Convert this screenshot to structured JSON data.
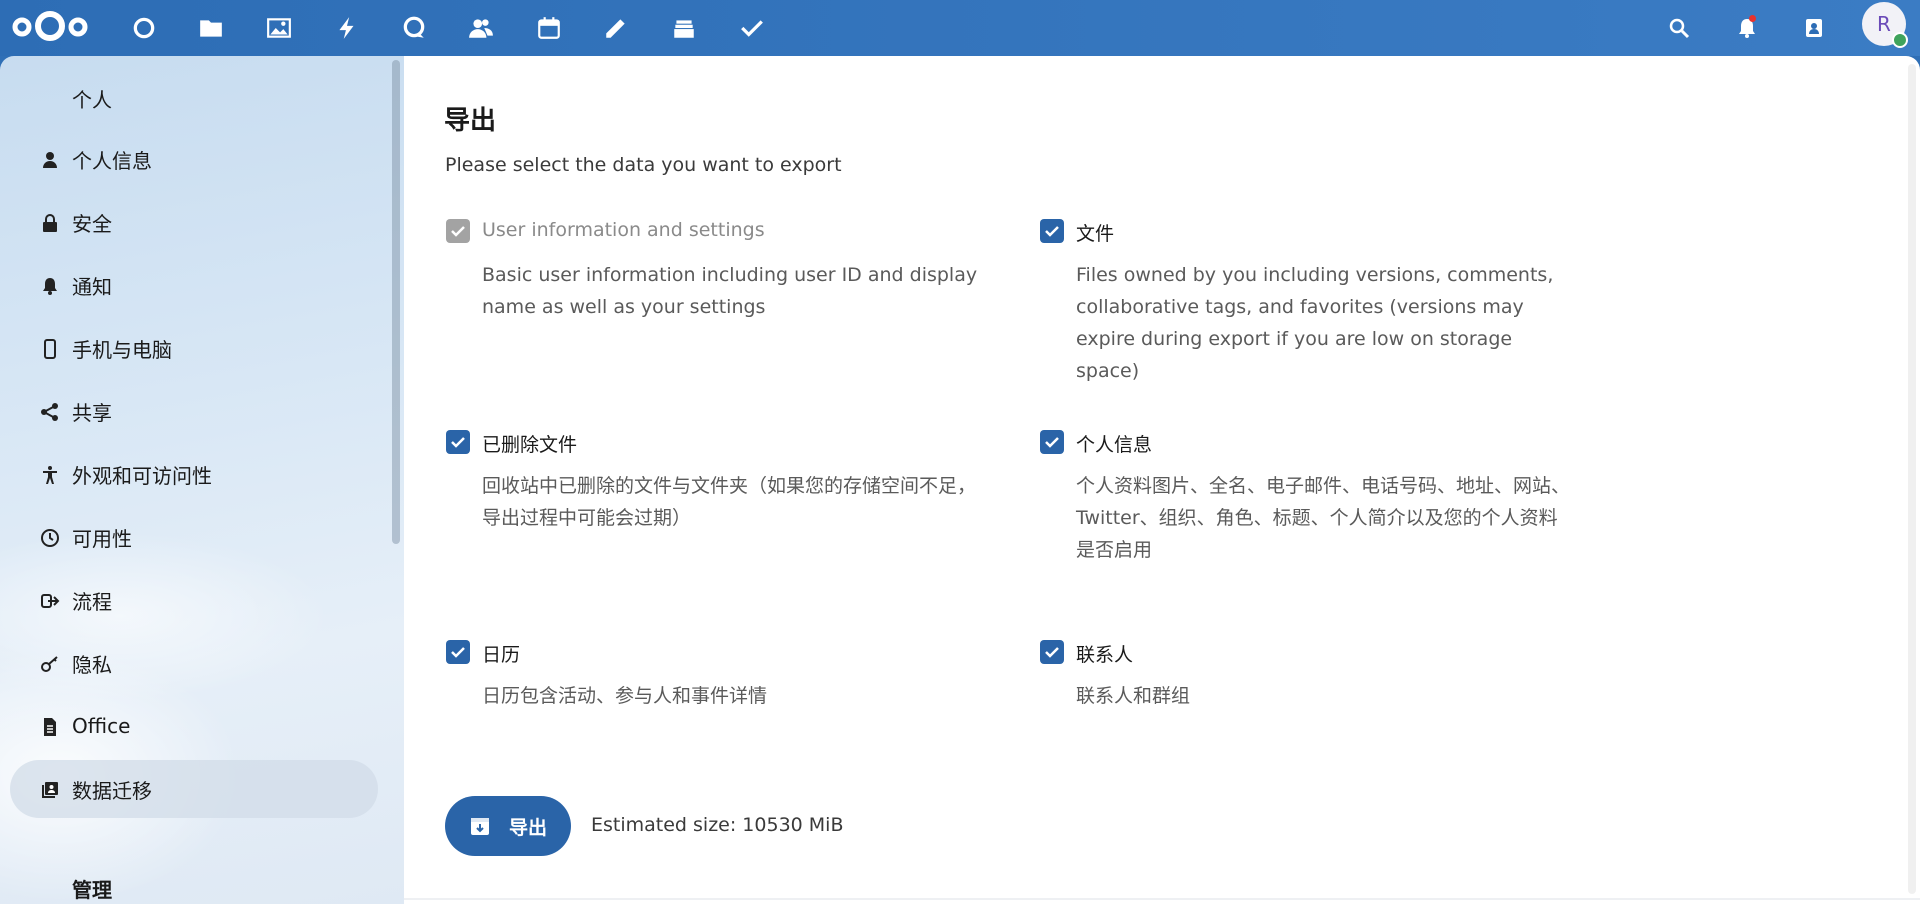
{
  "header": {
    "apps": [
      {
        "icon": "dashboard-icon"
      },
      {
        "icon": "files-icon"
      },
      {
        "icon": "photos-icon"
      },
      {
        "icon": "activity-icon"
      },
      {
        "icon": "talk-icon"
      },
      {
        "icon": "contacts-icon"
      },
      {
        "icon": "calendar-icon"
      },
      {
        "icon": "notes-icon"
      },
      {
        "icon": "deck-icon"
      },
      {
        "icon": "tasks-icon"
      }
    ],
    "avatar_letter": "R"
  },
  "sidebar": {
    "personal_title": "个人",
    "items": [
      {
        "label": "个人信息",
        "icon": "person-icon"
      },
      {
        "label": "安全",
        "icon": "lock-icon"
      },
      {
        "label": "通知",
        "icon": "bell-icon"
      },
      {
        "label": "手机与电脑",
        "icon": "phone-icon"
      },
      {
        "label": "共享",
        "icon": "share-icon"
      },
      {
        "label": "外观和可访问性",
        "icon": "accessibility-icon"
      },
      {
        "label": "可用性",
        "icon": "clock-icon"
      },
      {
        "label": "流程",
        "icon": "flow-icon"
      },
      {
        "label": "隐私",
        "icon": "key-icon"
      },
      {
        "label": "Office",
        "icon": "document-icon"
      },
      {
        "label": "数据迁移",
        "icon": "migration-icon"
      }
    ],
    "admin_title": "管理"
  },
  "main": {
    "title": "导出",
    "subtitle": "Please select the data you want to export",
    "options": [
      {
        "label": "User information and settings",
        "desc": "Basic user information including user ID and display name as well as your settings",
        "checked": true,
        "disabled": true
      },
      {
        "label": "文件",
        "desc": "Files owned by you including versions, comments, collaborative tags, and favorites (versions may expire during export if you are low on storage space)",
        "checked": true,
        "disabled": false
      },
      {
        "label": "已删除文件",
        "desc": "回收站中已删除的文件与文件夹（如果您的存储空间不足，导出过程中可能会过期）",
        "checked": true,
        "disabled": false
      },
      {
        "label": "个人信息",
        "desc": "个人资料图片、全名、电子邮件、电话号码、地址、网站、Twitter、组织、角色、标题、个人简介以及您的个人资料是否启用",
        "checked": true,
        "disabled": false
      },
      {
        "label": "日历",
        "desc": "日历包含活动、参与人和事件详情",
        "checked": true,
        "disabled": false
      },
      {
        "label": "联系人",
        "desc": "联系人和群组",
        "checked": true,
        "disabled": false
      }
    ],
    "export_button": "导出",
    "estimated_size": "Estimated size: 10530 MiB"
  },
  "colors": {
    "header": "#2d6db5",
    "accent": "#2a64a8",
    "checkbox_disabled": "#a3a3a3"
  }
}
